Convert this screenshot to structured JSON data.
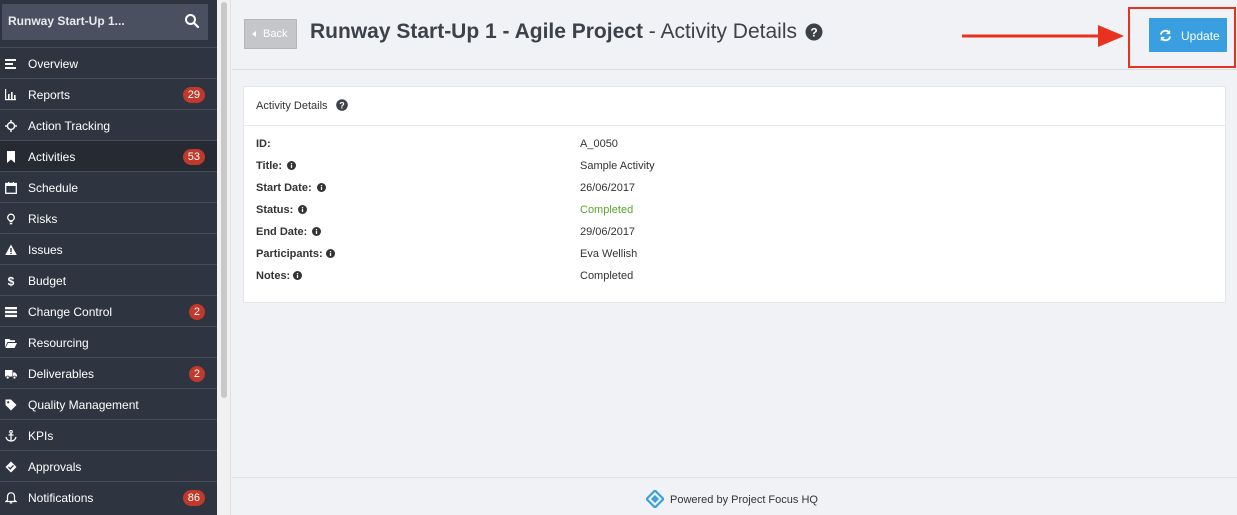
{
  "sidebar": {
    "project_name": "Runway Start-Up 1...",
    "search_icon": "search-icon",
    "items": [
      {
        "label": "Overview",
        "icon": "list-icon",
        "badge": ""
      },
      {
        "label": "Reports",
        "icon": "bar-chart-icon",
        "badge": "29"
      },
      {
        "label": "Action Tracking",
        "icon": "crosshair-icon",
        "badge": ""
      },
      {
        "label": "Activities",
        "icon": "bookmark-icon",
        "badge": "53",
        "active": true
      },
      {
        "label": "Schedule",
        "icon": "calendar-icon",
        "badge": ""
      },
      {
        "label": "Risks",
        "icon": "lightbulb-icon",
        "badge": ""
      },
      {
        "label": "Issues",
        "icon": "warning-icon",
        "badge": ""
      },
      {
        "label": "Budget",
        "icon": "dollar-icon",
        "badge": ""
      },
      {
        "label": "Change Control",
        "icon": "server-icon",
        "badge": "2"
      },
      {
        "label": "Resourcing",
        "icon": "folder-open-icon",
        "badge": ""
      },
      {
        "label": "Deliverables",
        "icon": "truck-icon",
        "badge": "2"
      },
      {
        "label": "Quality Management",
        "icon": "tag-icon",
        "badge": ""
      },
      {
        "label": "KPIs",
        "icon": "anchor-icon",
        "badge": ""
      },
      {
        "label": "Approvals",
        "icon": "tick-tag-icon",
        "badge": ""
      },
      {
        "label": "Notifications",
        "icon": "bell-icon",
        "badge": "86"
      }
    ]
  },
  "header": {
    "back_label": "Back",
    "title_bold": "Runway Start-Up 1 - Agile Project",
    "title_rest": " - Activity Details",
    "update_label": "Update"
  },
  "panel": {
    "title": "Activity Details",
    "fields": [
      {
        "key": "ID:",
        "value": "A_0050",
        "info": false
      },
      {
        "key": "Title:",
        "value": "Sample Activity",
        "info": true
      },
      {
        "key": "Start Date:",
        "value": "26/06/2017",
        "info": true
      },
      {
        "key": "Status:",
        "value": "Completed",
        "info": true,
        "status": true
      },
      {
        "key": "End Date:",
        "value": "29/06/2017",
        "info": true
      },
      {
        "key": "Participants:",
        "value": "Eva Wellish",
        "info": true
      },
      {
        "key": "Notes:",
        "value": "Completed",
        "info": true
      }
    ]
  },
  "footer": {
    "text": "Powered by Project Focus HQ"
  },
  "colors": {
    "sidebar_bg": "#2f3540",
    "badge": "#c0392b",
    "update_button": "#3a9fe0",
    "status_completed": "#5ba52d",
    "highlight": "#e8321e"
  }
}
